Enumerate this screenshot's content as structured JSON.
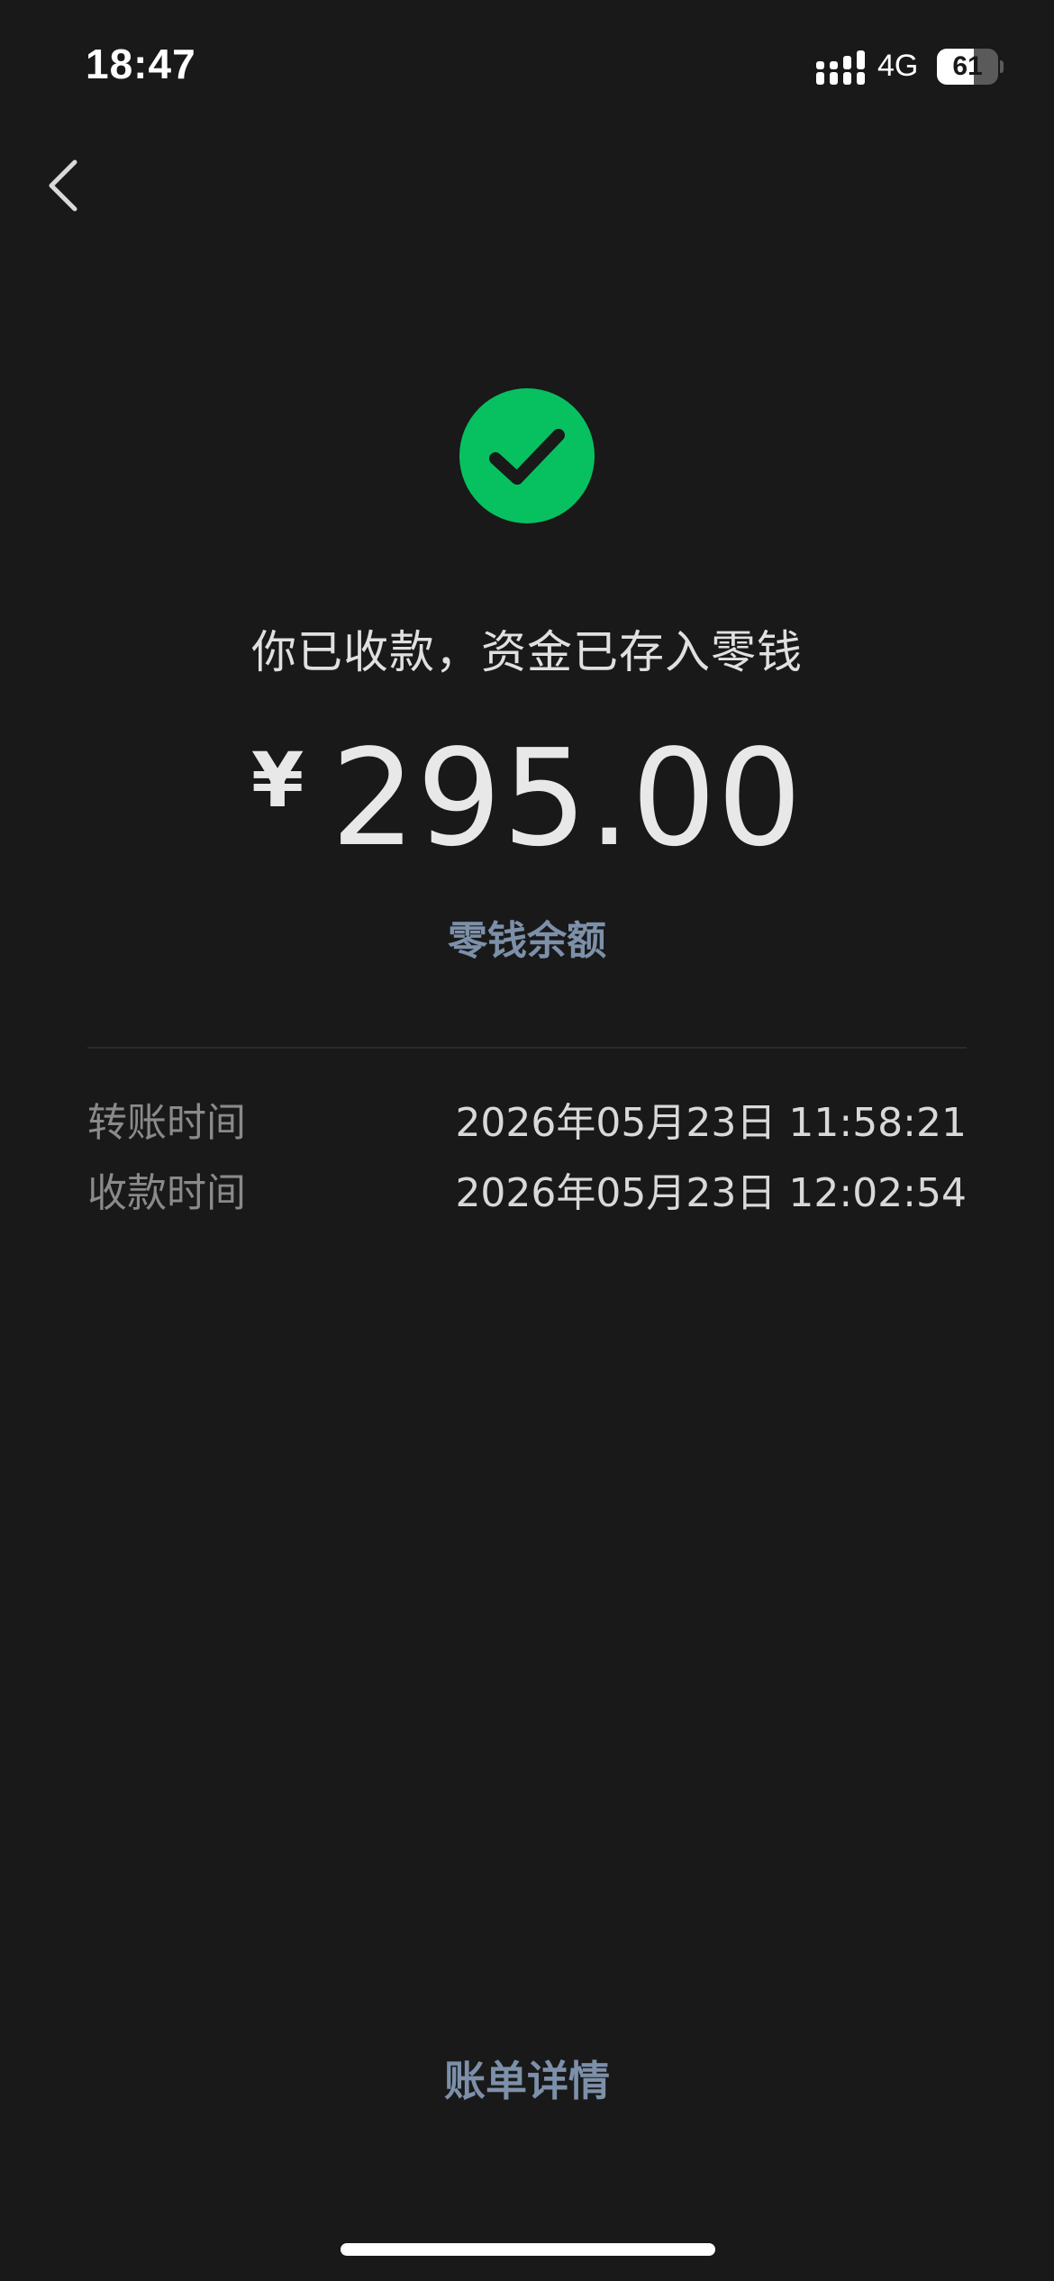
{
  "status_bar": {
    "time": "18:47",
    "network": "4G",
    "battery": "61",
    "battery_fraction": 0.61,
    "signal_icon": "signal-bars-icon"
  },
  "nav": {
    "back_icon": "chevron-left-icon"
  },
  "receipt": {
    "success_icon": "checkmark-circle-icon",
    "success_color": "#07c160",
    "message": "你已收款，资金已存入零钱",
    "currency_symbol": "¥",
    "amount": "295.00",
    "balance_link": "零钱余额"
  },
  "details": [
    {
      "label": "转账时间",
      "value": "2026年05月23日 11:58:21"
    },
    {
      "label": "收款时间",
      "value": "2026年05月23日 12:02:54"
    }
  ],
  "footer": {
    "bill_details": "账单详情"
  },
  "colors": {
    "background": "#191919",
    "link": "#7d90a9",
    "label": "#8a8a8a"
  }
}
